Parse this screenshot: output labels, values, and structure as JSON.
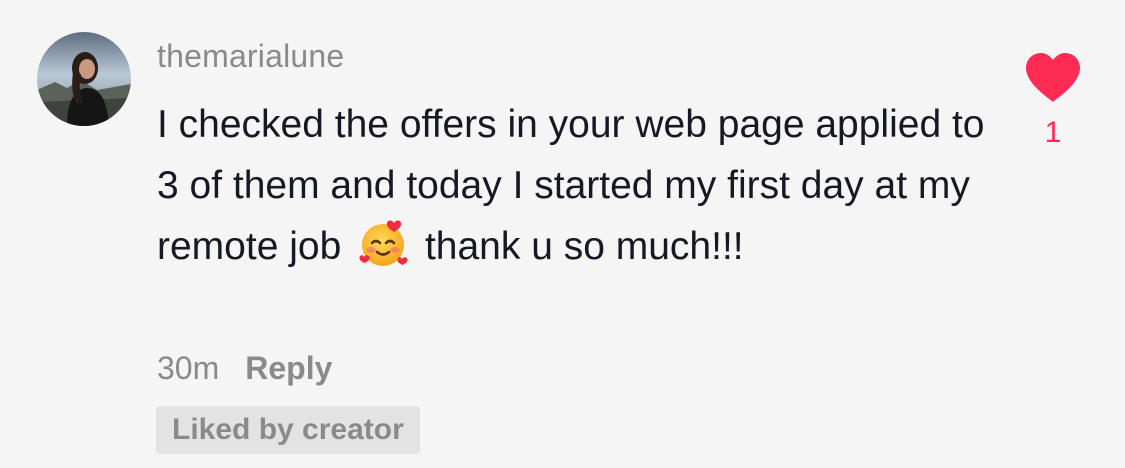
{
  "comment": {
    "username": "themarialune",
    "text_part1": "I checked the offers in your web page applied to 3 of them and today I started my first day at my remote job",
    "text_part2": "thank u so much!!!",
    "emoji_icon": "smiling-face-with-hearts-icon",
    "timestamp": "30m",
    "reply_label": "Reply",
    "liked_by_creator_label": "Liked by creator",
    "like_count": "1",
    "like_icon": "heart-icon",
    "like_color": "#fe2c55"
  }
}
